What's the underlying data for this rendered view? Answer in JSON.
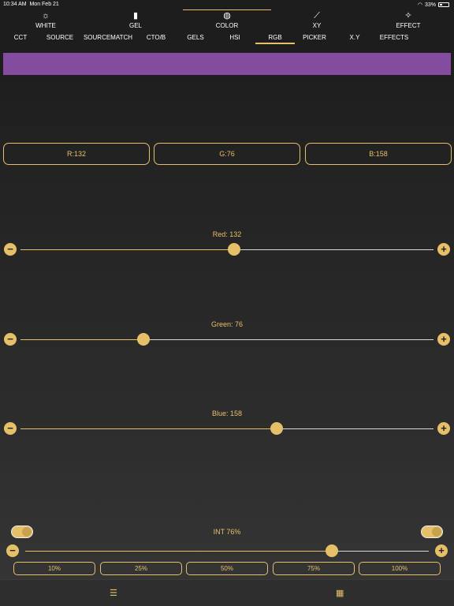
{
  "status_bar": {
    "time": "10:34 AM",
    "date": "Mon Feb 21",
    "battery": "33%"
  },
  "top_tabs": [
    {
      "label": "WHITE",
      "icon": "sun-icon"
    },
    {
      "label": "GEL",
      "icon": "gel-icon"
    },
    {
      "label": "COLOR",
      "icon": "palette-icon"
    },
    {
      "label": "XY",
      "icon": "chart-icon"
    },
    {
      "label": "EFFECT",
      "icon": "wand-icon"
    }
  ],
  "sub_tabs": [
    "CCT",
    "SOURCE",
    "SOURCEMATCH",
    "CTO/B",
    "GELS",
    "HSI",
    "RGB",
    "PICKER",
    "X.Y",
    "EFFECTS"
  ],
  "active_sub_tab": "RGB",
  "swatch_color": "#844c9e",
  "rgb_values": {
    "r": "R:132",
    "g": "G:76",
    "b": "B:158"
  },
  "sliders": {
    "red": {
      "label": "Red: 132",
      "value": 132,
      "max": 255
    },
    "green": {
      "label": "Green: 76",
      "value": 76,
      "max": 255
    },
    "blue": {
      "label": "Blue: 158",
      "value": 158,
      "max": 255
    }
  },
  "intensity": {
    "label": "INT  76%",
    "value": 76,
    "max": 100
  },
  "presets": [
    "10%",
    "25%",
    "50%",
    "75%",
    "100%"
  ],
  "colors": {
    "accent": "#e6c068"
  }
}
